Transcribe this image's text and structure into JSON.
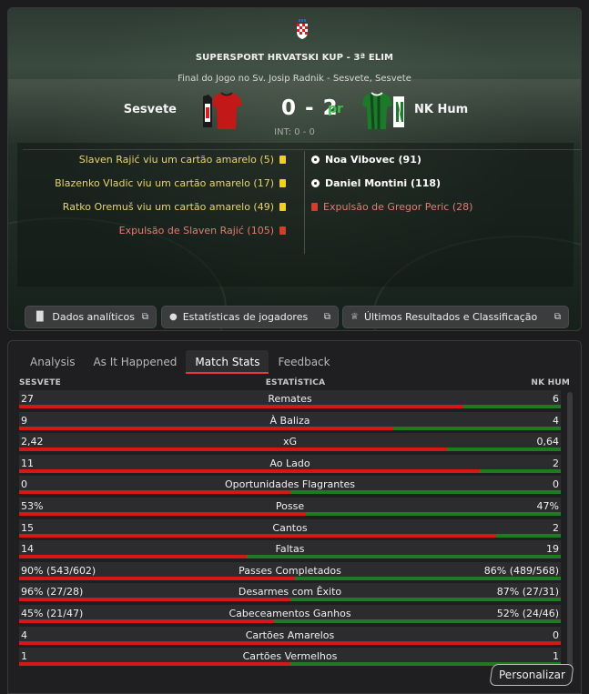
{
  "match": {
    "competition": "SUPERSPORT HRVATSKI KUP - 3ª ELIM",
    "venue": "Final do Jogo no Sv. Josip Radnik - Sesvete, Sesvete",
    "home_team": "Sesvete",
    "away_team": "NK Hum",
    "score": "0 - 2",
    "score_suffix": "pr",
    "interval": "INT: 0 - 0"
  },
  "events": {
    "home": [
      {
        "text": "Slaven Rajić viu um cartão amarelo (5)",
        "type": "yellow"
      },
      {
        "text": "Blazenko Vladic viu um cartão amarelo (17)",
        "type": "yellow"
      },
      {
        "text": "Ratko Oremuš viu um cartão amarelo (49)",
        "type": "yellow"
      },
      {
        "text": "Expulsão de Slaven Rajić (105)",
        "type": "red"
      }
    ],
    "away": [
      {
        "text": "Noa Vibovec (91)",
        "type": "goal"
      },
      {
        "text": "Daniel Montini (118)",
        "type": "goal"
      },
      {
        "text": "Expulsão de Gregor Peric (28)",
        "type": "red"
      }
    ]
  },
  "toolbar": {
    "analytics": "Dados analíticos",
    "player_stats": "Estatísticas de jogadores",
    "results": "Últimos Resultados e Classificação"
  },
  "tabs": [
    "Analysis",
    "As It Happened",
    "Match Stats",
    "Feedback"
  ],
  "active_tab": "Match Stats",
  "stats_header": {
    "home": "SESVETE",
    "middle": "ESTATÍSTICA",
    "away": "NK HUM"
  },
  "stats": [
    {
      "home": "27",
      "label": "Remates",
      "away": "6",
      "home_share": 0.82
    },
    {
      "home": "9",
      "label": "À Baliza",
      "away": "4",
      "home_share": 0.69
    },
    {
      "home": "2,42",
      "label": "xG",
      "away": "0,64",
      "home_share": 0.79
    },
    {
      "home": "11",
      "label": "Ao Lado",
      "away": "2",
      "home_share": 0.85
    },
    {
      "home": "0",
      "label": "Oportunidades Flagrantes",
      "away": "0",
      "home_share": 0.5
    },
    {
      "home": "53%",
      "label": "Posse",
      "away": "47%",
      "home_share": 0.53
    },
    {
      "home": "15",
      "label": "Cantos",
      "away": "2",
      "home_share": 0.88
    },
    {
      "home": "14",
      "label": "Faltas",
      "away": "19",
      "home_share": 0.42
    },
    {
      "home": "90% (543/602)",
      "label": "Passes Completados",
      "away": "86% (489/568)",
      "home_share": 0.51
    },
    {
      "home": "96% (27/28)",
      "label": "Desarmes com Êxito",
      "away": "87% (27/31)",
      "home_share": 0.5
    },
    {
      "home": "45% (21/47)",
      "label": "Cabeceamentos Ganhos",
      "away": "52% (24/46)",
      "home_share": 0.47
    },
    {
      "home": "4",
      "label": "Cartões Amarelos",
      "away": "0",
      "home_share": 1.0
    },
    {
      "home": "1",
      "label": "Cartões Vermelhos",
      "away": "1",
      "home_share": 0.5
    }
  ],
  "customize_label": "Personalizar",
  "colors": {
    "home": "#d41818",
    "away": "#1f7a24",
    "accent_score": "#3bbf4a"
  },
  "icons": [
    "croatia-crest-icon",
    "home-kit-icon",
    "away-kit-icon",
    "yellow-card-icon",
    "red-card-icon",
    "goal-ball-icon",
    "bar-chart-icon",
    "person-icon",
    "trophy-icon",
    "external-link-icon"
  ]
}
